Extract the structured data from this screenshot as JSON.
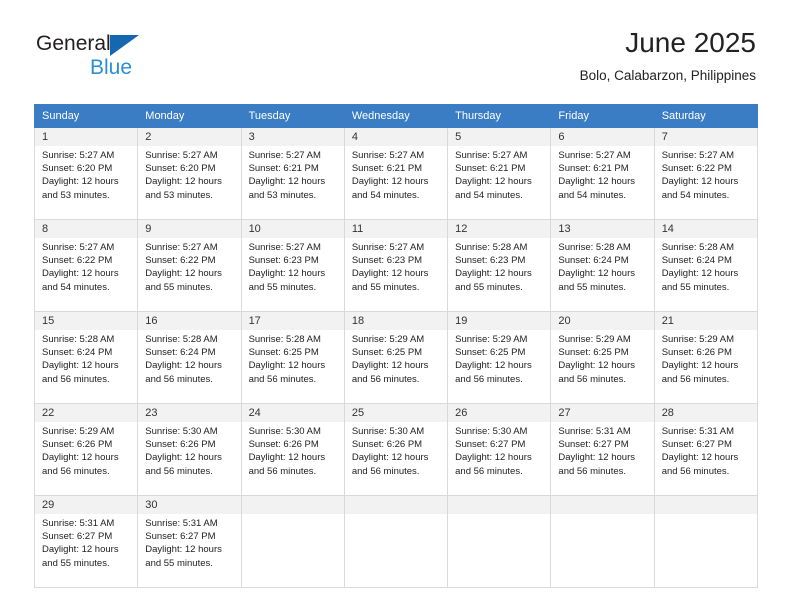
{
  "brand": {
    "name_part1": "General",
    "name_part2": "Blue",
    "triangle_icon": "blue-triangle-logo-mark",
    "color_dark": "#231f20",
    "color_blue": "#2a8fd4",
    "color_triangle": "#1667b2"
  },
  "header": {
    "title": "June 2025",
    "subtitle": "Bolo, Calabarzon, Philippines"
  },
  "calendar": {
    "header_background": "#3b7dc4",
    "daynum_background": "#f2f2f2",
    "border_color": "#d9d9d9",
    "weekday_headers": [
      "Sunday",
      "Monday",
      "Tuesday",
      "Wednesday",
      "Thursday",
      "Friday",
      "Saturday"
    ],
    "weeks": [
      [
        {
          "day": "1",
          "sunrise": "Sunrise: 5:27 AM",
          "sunset": "Sunset: 6:20 PM",
          "daylight_line1": "Daylight: 12 hours",
          "daylight_line2": "and 53 minutes."
        },
        {
          "day": "2",
          "sunrise": "Sunrise: 5:27 AM",
          "sunset": "Sunset: 6:20 PM",
          "daylight_line1": "Daylight: 12 hours",
          "daylight_line2": "and 53 minutes."
        },
        {
          "day": "3",
          "sunrise": "Sunrise: 5:27 AM",
          "sunset": "Sunset: 6:21 PM",
          "daylight_line1": "Daylight: 12 hours",
          "daylight_line2": "and 53 minutes."
        },
        {
          "day": "4",
          "sunrise": "Sunrise: 5:27 AM",
          "sunset": "Sunset: 6:21 PM",
          "daylight_line1": "Daylight: 12 hours",
          "daylight_line2": "and 54 minutes."
        },
        {
          "day": "5",
          "sunrise": "Sunrise: 5:27 AM",
          "sunset": "Sunset: 6:21 PM",
          "daylight_line1": "Daylight: 12 hours",
          "daylight_line2": "and 54 minutes."
        },
        {
          "day": "6",
          "sunrise": "Sunrise: 5:27 AM",
          "sunset": "Sunset: 6:21 PM",
          "daylight_line1": "Daylight: 12 hours",
          "daylight_line2": "and 54 minutes."
        },
        {
          "day": "7",
          "sunrise": "Sunrise: 5:27 AM",
          "sunset": "Sunset: 6:22 PM",
          "daylight_line1": "Daylight: 12 hours",
          "daylight_line2": "and 54 minutes."
        }
      ],
      [
        {
          "day": "8",
          "sunrise": "Sunrise: 5:27 AM",
          "sunset": "Sunset: 6:22 PM",
          "daylight_line1": "Daylight: 12 hours",
          "daylight_line2": "and 54 minutes."
        },
        {
          "day": "9",
          "sunrise": "Sunrise: 5:27 AM",
          "sunset": "Sunset: 6:22 PM",
          "daylight_line1": "Daylight: 12 hours",
          "daylight_line2": "and 55 minutes."
        },
        {
          "day": "10",
          "sunrise": "Sunrise: 5:27 AM",
          "sunset": "Sunset: 6:23 PM",
          "daylight_line1": "Daylight: 12 hours",
          "daylight_line2": "and 55 minutes."
        },
        {
          "day": "11",
          "sunrise": "Sunrise: 5:27 AM",
          "sunset": "Sunset: 6:23 PM",
          "daylight_line1": "Daylight: 12 hours",
          "daylight_line2": "and 55 minutes."
        },
        {
          "day": "12",
          "sunrise": "Sunrise: 5:28 AM",
          "sunset": "Sunset: 6:23 PM",
          "daylight_line1": "Daylight: 12 hours",
          "daylight_line2": "and 55 minutes."
        },
        {
          "day": "13",
          "sunrise": "Sunrise: 5:28 AM",
          "sunset": "Sunset: 6:24 PM",
          "daylight_line1": "Daylight: 12 hours",
          "daylight_line2": "and 55 minutes."
        },
        {
          "day": "14",
          "sunrise": "Sunrise: 5:28 AM",
          "sunset": "Sunset: 6:24 PM",
          "daylight_line1": "Daylight: 12 hours",
          "daylight_line2": "and 55 minutes."
        }
      ],
      [
        {
          "day": "15",
          "sunrise": "Sunrise: 5:28 AM",
          "sunset": "Sunset: 6:24 PM",
          "daylight_line1": "Daylight: 12 hours",
          "daylight_line2": "and 56 minutes."
        },
        {
          "day": "16",
          "sunrise": "Sunrise: 5:28 AM",
          "sunset": "Sunset: 6:24 PM",
          "daylight_line1": "Daylight: 12 hours",
          "daylight_line2": "and 56 minutes."
        },
        {
          "day": "17",
          "sunrise": "Sunrise: 5:28 AM",
          "sunset": "Sunset: 6:25 PM",
          "daylight_line1": "Daylight: 12 hours",
          "daylight_line2": "and 56 minutes."
        },
        {
          "day": "18",
          "sunrise": "Sunrise: 5:29 AM",
          "sunset": "Sunset: 6:25 PM",
          "daylight_line1": "Daylight: 12 hours",
          "daylight_line2": "and 56 minutes."
        },
        {
          "day": "19",
          "sunrise": "Sunrise: 5:29 AM",
          "sunset": "Sunset: 6:25 PM",
          "daylight_line1": "Daylight: 12 hours",
          "daylight_line2": "and 56 minutes."
        },
        {
          "day": "20",
          "sunrise": "Sunrise: 5:29 AM",
          "sunset": "Sunset: 6:25 PM",
          "daylight_line1": "Daylight: 12 hours",
          "daylight_line2": "and 56 minutes."
        },
        {
          "day": "21",
          "sunrise": "Sunrise: 5:29 AM",
          "sunset": "Sunset: 6:26 PM",
          "daylight_line1": "Daylight: 12 hours",
          "daylight_line2": "and 56 minutes."
        }
      ],
      [
        {
          "day": "22",
          "sunrise": "Sunrise: 5:29 AM",
          "sunset": "Sunset: 6:26 PM",
          "daylight_line1": "Daylight: 12 hours",
          "daylight_line2": "and 56 minutes."
        },
        {
          "day": "23",
          "sunrise": "Sunrise: 5:30 AM",
          "sunset": "Sunset: 6:26 PM",
          "daylight_line1": "Daylight: 12 hours",
          "daylight_line2": "and 56 minutes."
        },
        {
          "day": "24",
          "sunrise": "Sunrise: 5:30 AM",
          "sunset": "Sunset: 6:26 PM",
          "daylight_line1": "Daylight: 12 hours",
          "daylight_line2": "and 56 minutes."
        },
        {
          "day": "25",
          "sunrise": "Sunrise: 5:30 AM",
          "sunset": "Sunset: 6:26 PM",
          "daylight_line1": "Daylight: 12 hours",
          "daylight_line2": "and 56 minutes."
        },
        {
          "day": "26",
          "sunrise": "Sunrise: 5:30 AM",
          "sunset": "Sunset: 6:27 PM",
          "daylight_line1": "Daylight: 12 hours",
          "daylight_line2": "and 56 minutes."
        },
        {
          "day": "27",
          "sunrise": "Sunrise: 5:31 AM",
          "sunset": "Sunset: 6:27 PM",
          "daylight_line1": "Daylight: 12 hours",
          "daylight_line2": "and 56 minutes."
        },
        {
          "day": "28",
          "sunrise": "Sunrise: 5:31 AM",
          "sunset": "Sunset: 6:27 PM",
          "daylight_line1": "Daylight: 12 hours",
          "daylight_line2": "and 56 minutes."
        }
      ],
      [
        {
          "day": "29",
          "sunrise": "Sunrise: 5:31 AM",
          "sunset": "Sunset: 6:27 PM",
          "daylight_line1": "Daylight: 12 hours",
          "daylight_line2": "and 55 minutes."
        },
        {
          "day": "30",
          "sunrise": "Sunrise: 5:31 AM",
          "sunset": "Sunset: 6:27 PM",
          "daylight_line1": "Daylight: 12 hours",
          "daylight_line2": "and 55 minutes."
        },
        {
          "day": "",
          "sunrise": "",
          "sunset": "",
          "daylight_line1": "",
          "daylight_line2": ""
        },
        {
          "day": "",
          "sunrise": "",
          "sunset": "",
          "daylight_line1": "",
          "daylight_line2": ""
        },
        {
          "day": "",
          "sunrise": "",
          "sunset": "",
          "daylight_line1": "",
          "daylight_line2": ""
        },
        {
          "day": "",
          "sunrise": "",
          "sunset": "",
          "daylight_line1": "",
          "daylight_line2": ""
        },
        {
          "day": "",
          "sunrise": "",
          "sunset": "",
          "daylight_line1": "",
          "daylight_line2": ""
        }
      ]
    ]
  }
}
